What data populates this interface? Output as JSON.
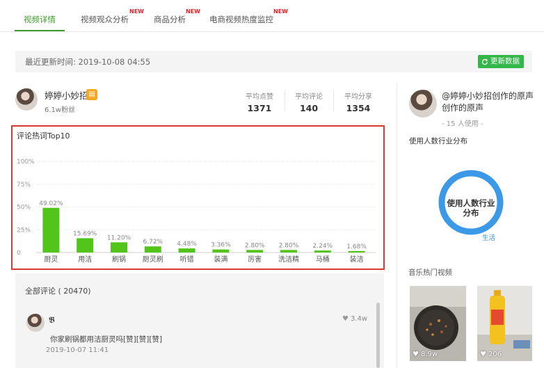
{
  "tabs": [
    {
      "label": "视频详情",
      "badge": ""
    },
    {
      "label": "视频观众分析",
      "badge": "NEW"
    },
    {
      "label": "商品分析",
      "badge": "NEW"
    },
    {
      "label": "电商视频热度监控",
      "badge": "NEW"
    }
  ],
  "update": {
    "text": "最近更新时间: 2019-10-08 04:55",
    "button": "更新数据"
  },
  "user": {
    "name": "婷婷小妙招",
    "fans": "6.1w粉丝"
  },
  "stats": [
    {
      "label": "平均点赞",
      "value": "1371"
    },
    {
      "label": "平均评论",
      "value": "140"
    },
    {
      "label": "平均分享",
      "value": "1354"
    }
  ],
  "chart_data": {
    "type": "bar",
    "title": "评论热词Top10",
    "categories": [
      "厨灵",
      "用洁",
      "刷锅",
      "厨灵刷",
      "听错",
      "装满",
      "厉害",
      "洗洁精",
      "马桶",
      "装洁"
    ],
    "values": [
      49.02,
      15.69,
      11.2,
      6.72,
      4.48,
      3.36,
      2.8,
      2.8,
      2.24,
      1.68
    ],
    "value_labels": [
      "49.02%",
      "15.69%",
      "11.20%",
      "6.72%",
      "4.48%",
      "3.36%",
      "2.80%",
      "2.80%",
      "2.24%",
      "1.68%"
    ],
    "y_ticks": [
      "0",
      "25%",
      "50%",
      "75%",
      "100%"
    ],
    "ylim": [
      0,
      100
    ],
    "grid": true,
    "bar_color": "#52c41a"
  },
  "comments": {
    "header": "全部评论 ( 20470)",
    "items": [
      {
        "user": "𝕭",
        "likes": "3.4w",
        "text": "你家刷锅都用洁厨灵吗[赞][赞][赞]",
        "time": "2019-10-07 11:41"
      }
    ]
  },
  "right": {
    "music_title": "@婷婷小妙招创作的原声    创作的原声",
    "usage": "- 15 人使用 -",
    "industry_section": "使用人数行业分布",
    "donut_label": "使用人数行业分布",
    "donut_legend": "生活",
    "donut_color": "#3b99e8",
    "hot_videos_title": "音乐热门视频",
    "videos": [
      {
        "count": "8.9w"
      },
      {
        "count": "206"
      }
    ]
  },
  "colors": {
    "accent": "#3d9d2b",
    "button": "#33b749",
    "highlight_border": "#d83a31"
  }
}
